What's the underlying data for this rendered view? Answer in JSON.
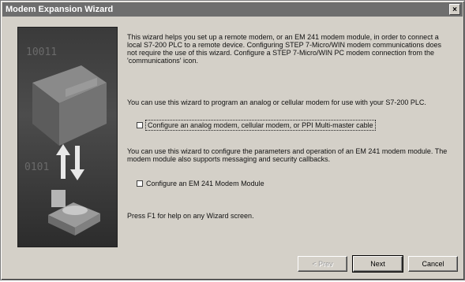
{
  "window": {
    "title": "Modem Expansion Wizard",
    "close_glyph": "×"
  },
  "panel": {
    "digits_top": "10011",
    "digits_bottom": "0101"
  },
  "intro": "This wizard helps you set up a remote modem, or an EM 241 modem module, in order to connect a local S7-200 PLC to a remote device. Configuring STEP 7-Micro/WIN modem communications does not require the use of this wizard. Configure a STEP 7-Micro/WIN PC modem connection from the 'communications' icon.",
  "analog_desc": "You can use this wizard to program an analog or cellular modem for use with your S7-200 PLC.",
  "option1": {
    "label": "Configure an analog modem, cellular modem, or PPI Multi-master cable"
  },
  "em_desc": "You can use this wizard to configure the parameters and operation of an EM 241 modem module. The modem module also supports messaging and security callbacks.",
  "option2": {
    "label": "Configure an EM 241 Modem Module"
  },
  "help_text": "Press F1 for help on any Wizard screen.",
  "buttons": {
    "prev": "< Prev",
    "next": "Next",
    "cancel": "Cancel"
  }
}
